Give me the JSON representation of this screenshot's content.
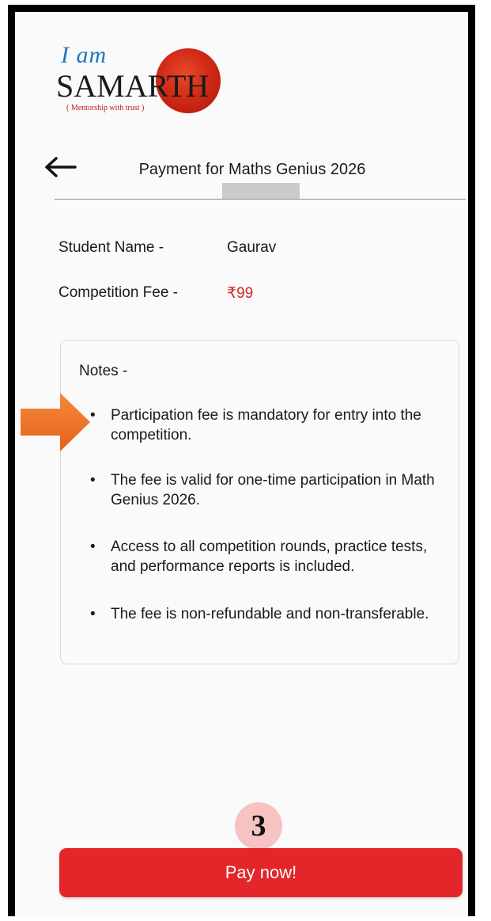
{
  "logo": {
    "iam": "I am",
    "brand": "SAMARTH",
    "tagline": "( Mentorship with trust )"
  },
  "header": {
    "title": "Payment for Maths Genius 2026"
  },
  "info": {
    "student_label": "Student Name -",
    "student_value": "Gaurav",
    "fee_label": "Competition Fee -",
    "fee_value": "₹99"
  },
  "notes": {
    "title": "Notes -",
    "items": [
      "Participation fee is mandatory for entry into the competition.",
      "The fee is valid for one-time participation in Math Genius 2026.",
      "Access to all competition rounds, practice tests, and performance reports is included.",
      "The fee is non-refundable and non-transferable."
    ]
  },
  "step_badge": "3",
  "pay_button": "Pay now!",
  "colors": {
    "accent_red": "#e2262a",
    "fee_red": "#d42424",
    "arrow_orange": "#f0742a",
    "badge_pink": "#f7c2c2"
  }
}
